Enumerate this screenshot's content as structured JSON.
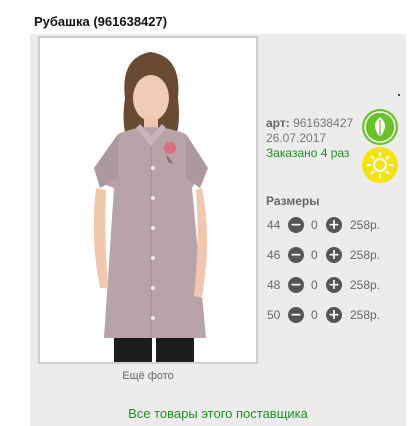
{
  "product": {
    "title": "Рубашка (961638427)",
    "art_label": "арт:",
    "art_value": "961638427",
    "date": "26.07.2017",
    "ordered": "Заказано 4 раз",
    "more_photos": "Ещё фото"
  },
  "badges": {
    "eco": {
      "icon": "leaf-icon",
      "color": "#6bc12a"
    },
    "sun": {
      "icon": "sun-icon",
      "color": "#f4e40c"
    }
  },
  "sizes": {
    "title": "Размеры",
    "rows": [
      {
        "size": "44",
        "qty": "0",
        "price": "258р."
      },
      {
        "size": "46",
        "qty": "0",
        "price": "258р."
      },
      {
        "size": "48",
        "qty": "0",
        "price": "258р."
      },
      {
        "size": "50",
        "qty": "0",
        "price": "258р."
      }
    ],
    "minus_icon": "−",
    "plus_icon": "+"
  },
  "footer": {
    "all_goods": "Все товары этого поставщика"
  },
  "colors": {
    "accent_green": "#1f8f1f",
    "shirt": "#b7a3a8"
  }
}
